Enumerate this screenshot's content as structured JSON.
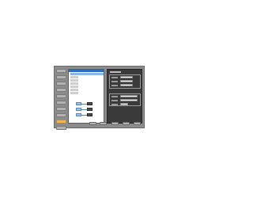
{
  "window": {
    "title": ""
  },
  "nav": {
    "items": [
      {
        "label": ""
      },
      {
        "label": ""
      },
      {
        "label": ""
      },
      {
        "label": ""
      },
      {
        "label": ""
      },
      {
        "label": ""
      },
      {
        "label": ""
      },
      {
        "label": ""
      },
      {
        "label": ""
      },
      {
        "label": ""
      }
    ],
    "active_index": 8
  },
  "list": {
    "items": [
      "",
      "",
      "",
      "",
      "",
      "",
      "",
      ""
    ]
  },
  "properties": {
    "title": "",
    "fields": [
      "",
      "",
      "",
      "",
      "",
      ""
    ]
  },
  "footer": {
    "buttons": [
      "",
      "",
      "",
      "",
      ""
    ]
  },
  "colors": {
    "window_bg": "#8c8c8c",
    "nav_active": "#f0b84a",
    "list_header": "#2f6fc0",
    "selection": "#8fb6e6",
    "prop_panel_bg": "#3a3a3a"
  }
}
